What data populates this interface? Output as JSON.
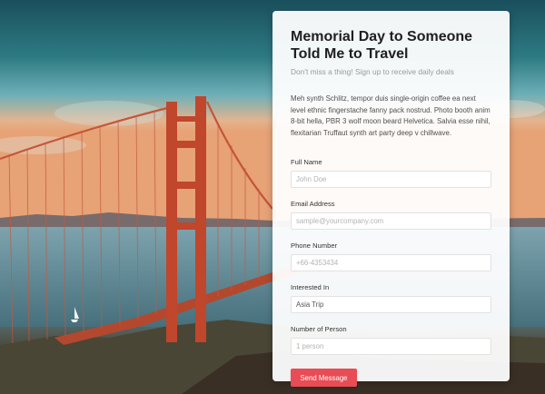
{
  "form": {
    "title": "Memorial Day to Someone Told Me to Travel",
    "subtitle": "Don't miss a thing! Sign up to receive daily deals",
    "description": "Meh synth Schlitz, tempor duis single-origin coffee ea next level ethnic fingerstache fanny pack nostrud. Photo booth anim 8-bit hella, PBR 3 wolf moon beard Helvetica. Salvia esse nihil, flexitarian Truffaut synth art party deep v chillwave.",
    "fields": {
      "full_name": {
        "label": "Full Name",
        "placeholder": "John Doe",
        "value": ""
      },
      "email": {
        "label": "Email Address",
        "placeholder": "sample@yourcompany.com",
        "value": ""
      },
      "phone": {
        "label": "Phone Number",
        "placeholder": "+66-4353434",
        "value": ""
      },
      "interest": {
        "label": "Interested In",
        "placeholder": "",
        "value": "Asia Trip"
      },
      "persons": {
        "label": "Number of Person",
        "placeholder": "1 person",
        "value": ""
      }
    },
    "submit_label": "Send Message",
    "accent_color": "#e84c55"
  },
  "background": {
    "image": "golden-gate-bridge-photo"
  }
}
